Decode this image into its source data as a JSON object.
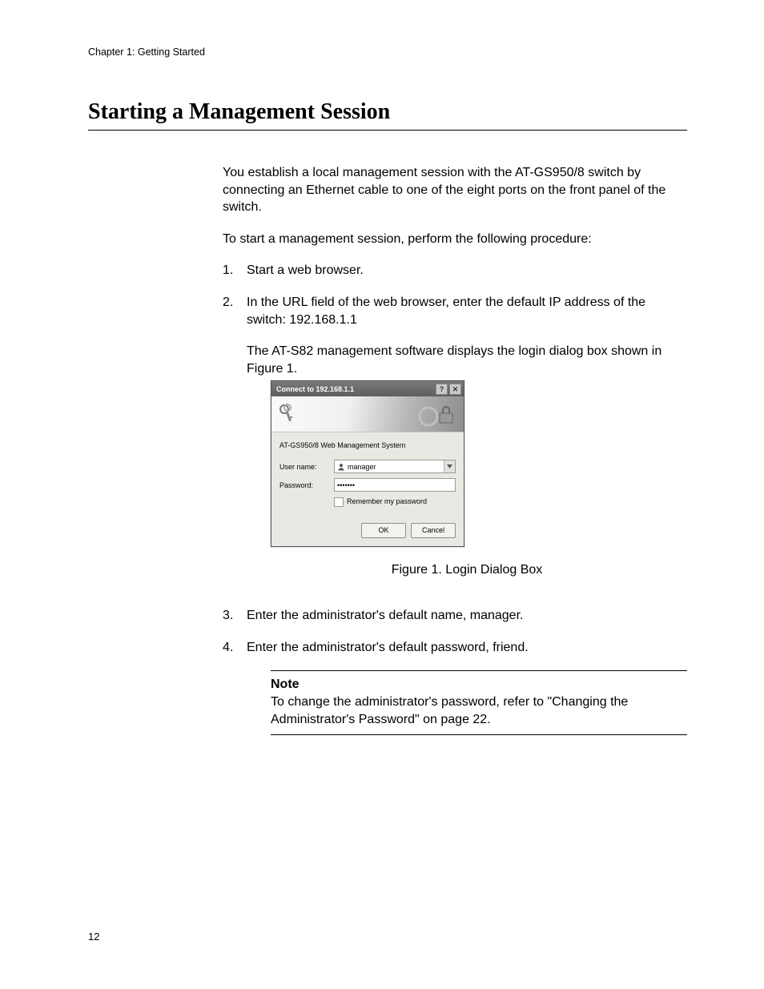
{
  "header": {
    "running": "Chapter 1: Getting Started"
  },
  "section": {
    "title": "Starting a Management Session",
    "intro": "You establish a local management session with the AT-GS950/8 switch by connecting an Ethernet cable to one of the eight ports on the front panel of the switch.",
    "lead": "To start a management session, perform the following procedure:",
    "steps": {
      "s1": {
        "num": "1.",
        "text": "Start a web browser."
      },
      "s2": {
        "num": "2.",
        "text": "In the URL field of the web browser, enter the default IP address of the switch: 192.168.1.1",
        "sub": "The AT-S82 management software displays the login dialog box shown in Figure 1."
      },
      "s3": {
        "num": "3.",
        "text": "Enter the administrator's default name, manager."
      },
      "s4": {
        "num": "4.",
        "text": "Enter the administrator's default password, friend."
      }
    },
    "figure_caption": "Figure 1. Login Dialog Box",
    "note": {
      "label": "Note",
      "text": "To change the administrator's password, refer to \"Changing the Administrator's Password\" on page 22."
    }
  },
  "dialog": {
    "title": "Connect to 192.168.1.1",
    "subtitle": "AT-GS950/8 Web Management System",
    "username_label": "User name:",
    "username_value": "manager",
    "password_label": "Password:",
    "password_value": "•••••••",
    "remember": "Remember my password",
    "ok": "OK",
    "cancel": "Cancel"
  },
  "page_number": "12"
}
